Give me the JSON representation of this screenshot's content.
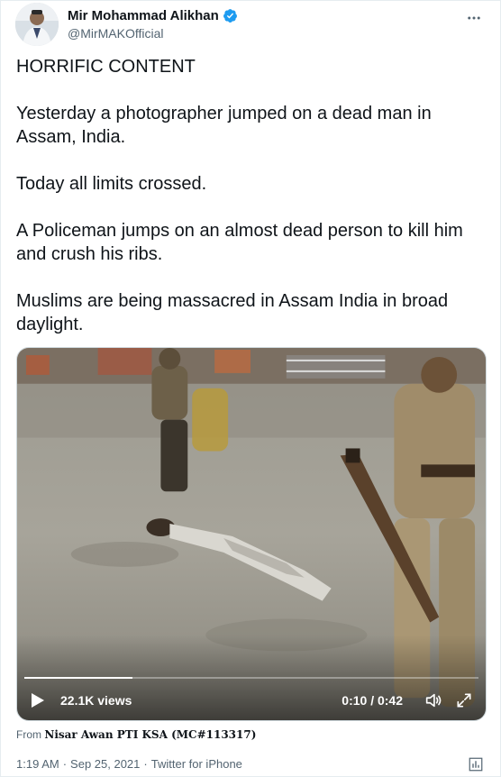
{
  "author": {
    "display_name": "Mir Mohammad Alikhan",
    "handle": "@MirMAKOfficial",
    "verified_icon": "verified-badge-icon",
    "avatar_icon": "avatar"
  },
  "more_icon": "more-options-icon",
  "tweet": {
    "paragraphs": [
      "HORRIFIC CONTENT",
      "Yesterday a photographer jumped on a dead man in Assam, India.",
      "Today all limits crossed.",
      "A Policeman jumps on an almost dead person to kill him and crush his ribs.",
      "Muslims are being massacred in Assam India in broad daylight."
    ]
  },
  "video": {
    "views": "22.1K views",
    "time": "0:10 / 0:42",
    "progress": 0.238,
    "play_icon": "play-icon",
    "volume_icon": "volume-icon",
    "fullscreen_icon": "fullscreen-icon"
  },
  "source": {
    "prefix": "From",
    "name": "Nisar Awan PTI KSA (MC#113317)"
  },
  "meta": {
    "time": "1:19 AM",
    "separator": "·",
    "date": "Sep 25, 2021",
    "client": "Twitter for iPhone",
    "analytics_icon": "analytics-icon"
  },
  "colors": {
    "verified": "#1d9bf0",
    "secondary_text": "#536471",
    "primary_text": "#0f1419"
  }
}
